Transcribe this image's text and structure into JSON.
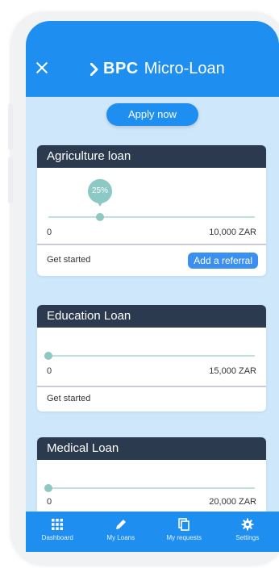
{
  "header": {
    "brand_bold": "BPC",
    "brand_light": "Micro-Loan",
    "close_icon": "close-icon",
    "brand_icon": "chevron-right-icon"
  },
  "apply_button": {
    "label": "Apply now"
  },
  "loans": [
    {
      "title": "Agriculture loan",
      "min_label": "0",
      "max_label": "10,000 ZAR",
      "progress_percent": 25,
      "bubble_label": "25%",
      "footer_label": "Get started",
      "referral_label": "Add a referral"
    },
    {
      "title": "Education Loan",
      "min_label": "0",
      "max_label": "15,000 ZAR",
      "progress_percent": 0,
      "footer_label": "Get started"
    },
    {
      "title": "Medical Loan",
      "min_label": "0",
      "max_label": "20,000 ZAR",
      "progress_percent": 0
    }
  ],
  "nav": {
    "items": [
      {
        "label": "Dashboard",
        "icon": "grid-icon"
      },
      {
        "label": "My Loans",
        "icon": "pencil-icon"
      },
      {
        "label": "My requests",
        "icon": "copy-icon"
      },
      {
        "label": "Settings",
        "icon": "gear-icon"
      }
    ]
  },
  "colors": {
    "primary": "#1e8ff0",
    "card_header": "#2c3a4f",
    "slider": "#8cc8c4",
    "background": "#cfe7fb"
  }
}
